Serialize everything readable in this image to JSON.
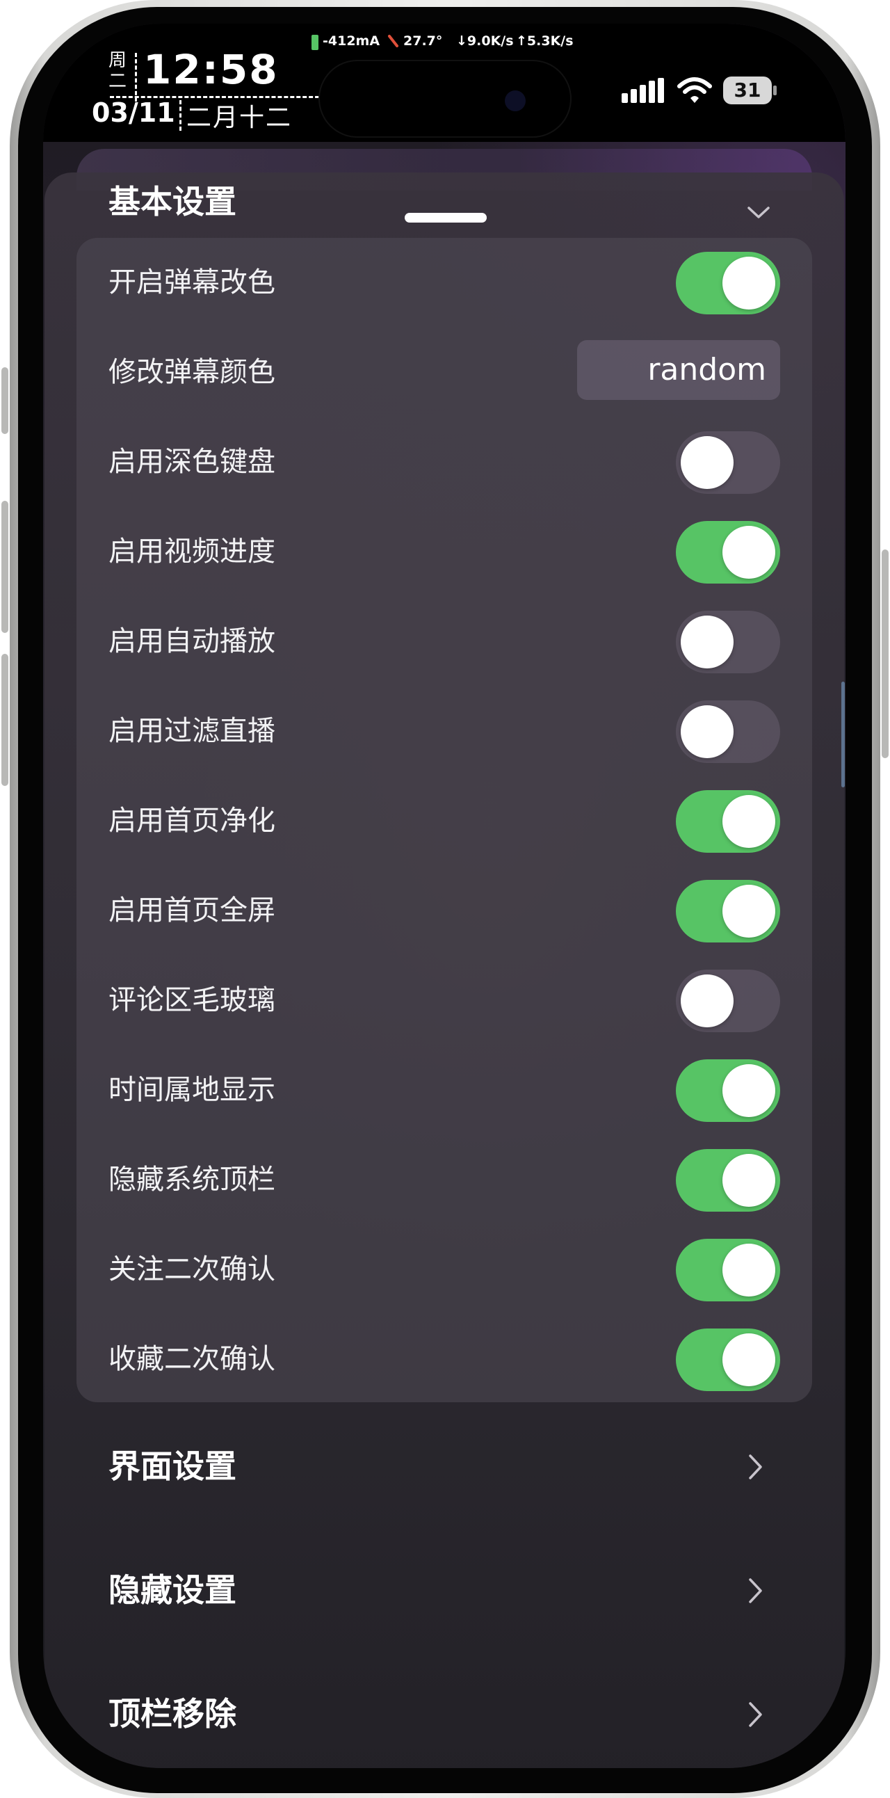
{
  "status_bar": {
    "weekday": "周二",
    "time": "12:58",
    "date": "03/11",
    "lunar_date": "二月十二",
    "battery_current": "-412mA",
    "temperature": "27.7°",
    "net_down": "↓9.0K/s",
    "net_up": "↑5.3K/s",
    "battery_level": "31"
  },
  "sheet": {
    "section_title": "基本设置"
  },
  "settings": [
    {
      "label": "开启弹幕改色",
      "type": "toggle",
      "on": true
    },
    {
      "label": "修改弹幕颜色",
      "type": "text",
      "value": "random"
    },
    {
      "label": "启用深色键盘",
      "type": "toggle",
      "on": false
    },
    {
      "label": "启用视频进度",
      "type": "toggle",
      "on": true
    },
    {
      "label": "启用自动播放",
      "type": "toggle",
      "on": false
    },
    {
      "label": "启用过滤直播",
      "type": "toggle",
      "on": false
    },
    {
      "label": "启用首页净化",
      "type": "toggle",
      "on": true
    },
    {
      "label": "启用首页全屏",
      "type": "toggle",
      "on": true
    },
    {
      "label": "评论区毛玻璃",
      "type": "toggle",
      "on": false
    },
    {
      "label": "时间属地显示",
      "type": "toggle",
      "on": true
    },
    {
      "label": "隐藏系统顶栏",
      "type": "toggle",
      "on": true
    },
    {
      "label": "关注二次确认",
      "type": "toggle",
      "on": true
    },
    {
      "label": "收藏二次确认",
      "type": "toggle",
      "on": true
    }
  ],
  "nav": [
    {
      "label": "界面设置"
    },
    {
      "label": "隐藏设置"
    },
    {
      "label": "顶栏移除"
    }
  ],
  "colors": {
    "toggle_on": "#57c465",
    "toggle_off": "#5a5262",
    "sheet_bg": "#3a3440"
  }
}
